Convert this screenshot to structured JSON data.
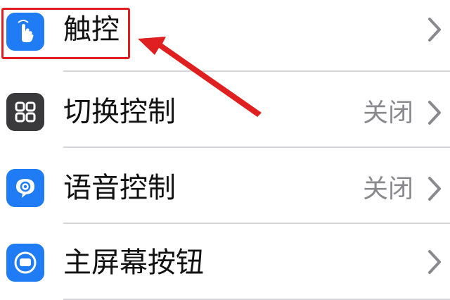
{
  "settings_list": {
    "items": [
      {
        "label": "触控",
        "value": "",
        "icon": "touch-hand-icon",
        "icon_color": "#1f7cf5"
      },
      {
        "label": "切换控制",
        "value": "关闭",
        "icon": "switch-control-grid-icon",
        "icon_color": "#3a3a3c"
      },
      {
        "label": "语音控制",
        "value": "关闭",
        "icon": "voice-control-icon",
        "icon_color": "#1f7cf5"
      },
      {
        "label": "主屏幕按钮",
        "value": "",
        "icon": "home-button-icon",
        "icon_color": "#1f7cf5"
      }
    ]
  },
  "annotation": {
    "highlight_color": "#e02020",
    "target": "触控"
  }
}
